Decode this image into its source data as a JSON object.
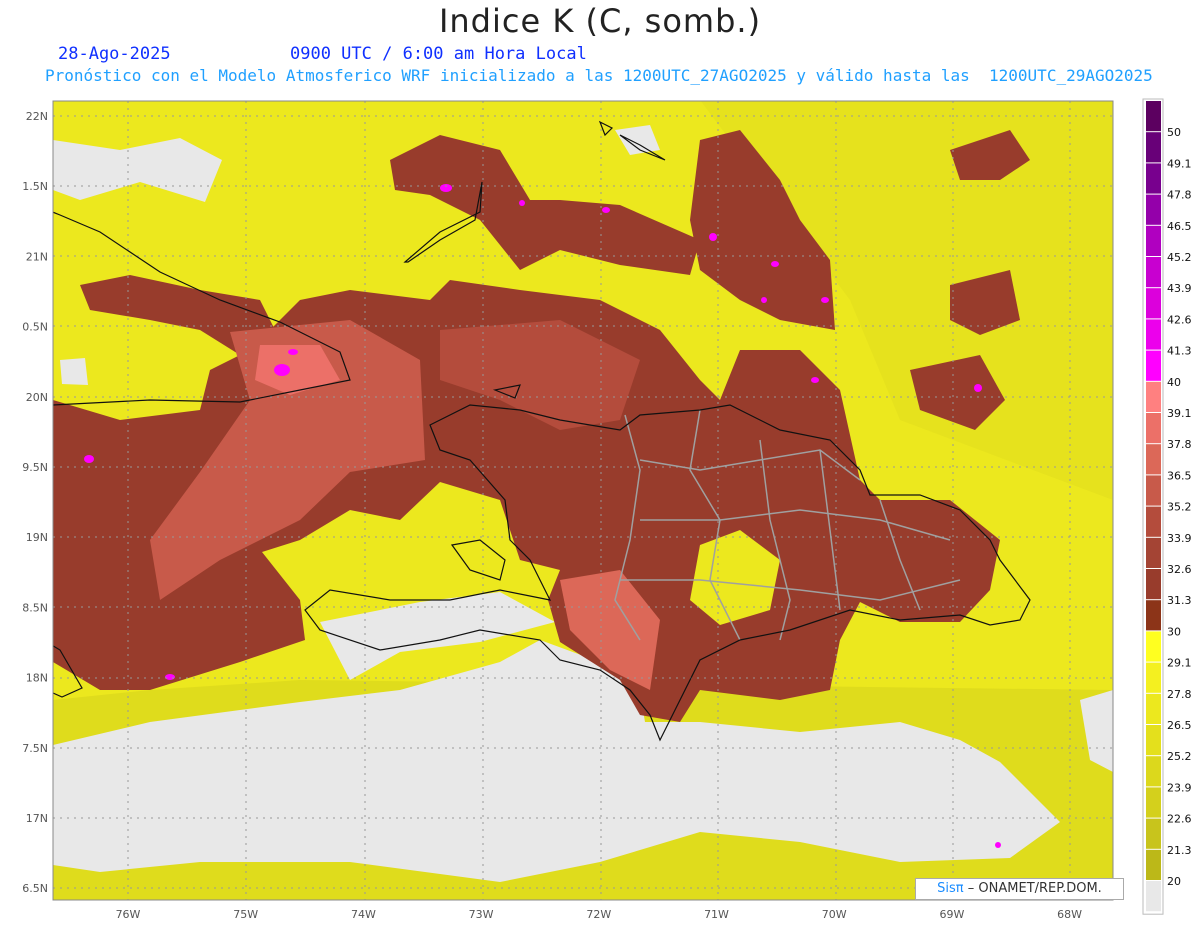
{
  "title": "Indice K (C, somb.)",
  "date": "28-Ago-2025",
  "time": "0900 UTC / 6:00 am Hora Local",
  "description": "Pronóstico con el Modelo Atmosferico WRF inicializado a las 1200UTC_27AGO2025 y válido hasta las  1200UTC_29AGO2025",
  "credit": {
    "logo": "Sisπ",
    "text": "– ONAMET/REP.DOM."
  },
  "axes": {
    "lon_labels": [
      "76W",
      "75W",
      "74W",
      "73W",
      "72W",
      "71W",
      "70W",
      "69W",
      "68W"
    ],
    "lat_labels": [
      "22N",
      "1.5N",
      "21N",
      "0.5N",
      "20N",
      "9.5N",
      "19N",
      "8.5N",
      "18N",
      "7.5N",
      "17N",
      "6.5N"
    ]
  },
  "legend": {
    "labels": [
      "50",
      "49.1",
      "47.8",
      "46.5",
      "45.2",
      "43.9",
      "42.6",
      "41.3",
      "40",
      "39.1",
      "37.8",
      "36.5",
      "35.2",
      "33.9",
      "32.6",
      "31.3",
      "30",
      "29.1",
      "27.8",
      "26.5",
      "25.2",
      "23.9",
      "22.6",
      "21.3",
      "20"
    ],
    "colors": [
      "#5c0060",
      "#680078",
      "#78008e",
      "#9400aa",
      "#b000c0",
      "#c800d0",
      "#dc00dc",
      "#ec00ec",
      "#ff00ff",
      "#ff8080",
      "#ec7068",
      "#dc6858",
      "#c85a4a",
      "#b44c3c",
      "#a44434",
      "#983c2c",
      "#8c3418",
      "#ffff20",
      "#f4f020",
      "#ece81e",
      "#e4e01c",
      "#dcd81c",
      "#d4d01c",
      "#c8c41c",
      "#bcb818",
      "#e8e8e8"
    ]
  }
}
